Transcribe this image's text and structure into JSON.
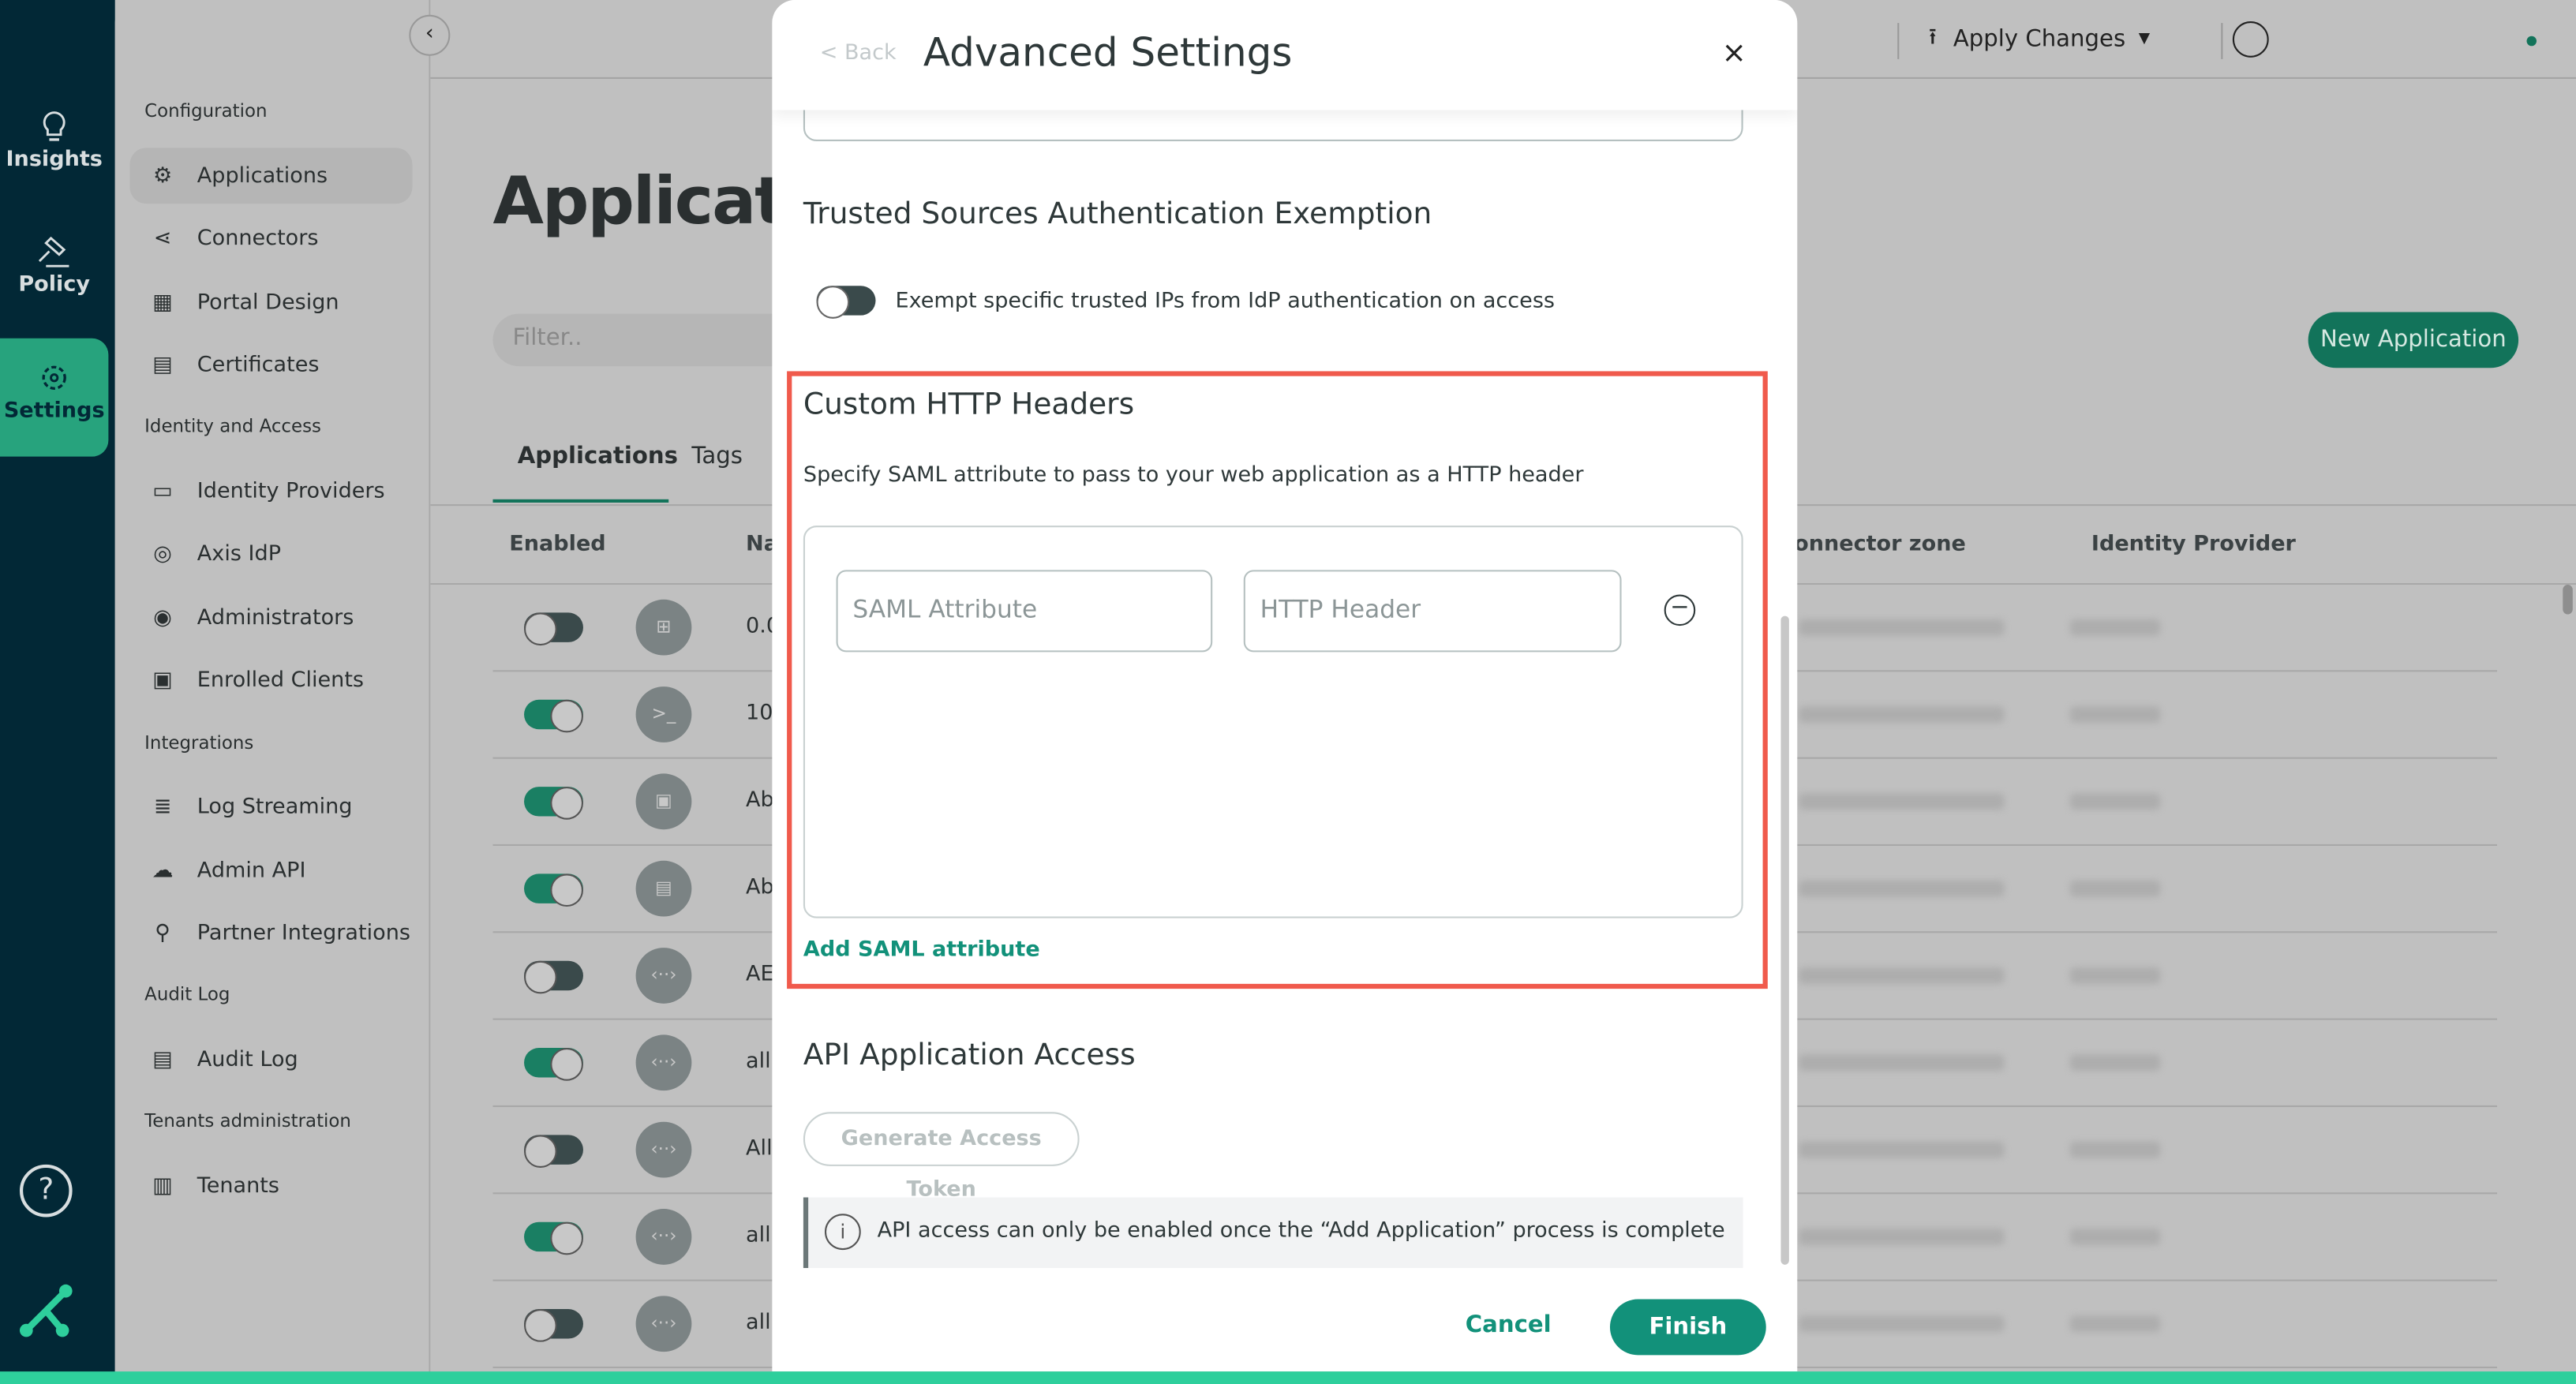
{
  "rail": {
    "items": [
      {
        "label": "Insights",
        "icon": "lightbulb-icon"
      },
      {
        "label": "Policy",
        "icon": "gavel-icon"
      },
      {
        "label": "Settings",
        "icon": "gear-icon",
        "active": true
      }
    ],
    "help_icon": "question-icon",
    "logo_icon": "axis-logo-icon"
  },
  "subnav": {
    "sections": [
      {
        "title": "Configuration",
        "items": [
          "Applications",
          "Connectors",
          "Portal Design",
          "Certificates"
        ]
      },
      {
        "title": "Identity and Access",
        "items": [
          "Identity Providers",
          "Axis IdP",
          "Administrators",
          "Enrolled Clients"
        ]
      },
      {
        "title": "Integrations",
        "items": [
          "Log Streaming",
          "Admin API",
          "Partner Integrations"
        ]
      },
      {
        "title": "Audit Log",
        "items": [
          "Audit Log"
        ]
      },
      {
        "title": "Tenants administration",
        "items": [
          "Tenants"
        ]
      }
    ],
    "active": "Applications"
  },
  "topbar": {
    "apply_changes": "Apply Changes"
  },
  "page": {
    "title": "Applications",
    "filter_placeholder": "Filter..",
    "new_application": "New Application",
    "tabs": [
      "Applications",
      "Tags"
    ],
    "columns": {
      "enabled": "Enabled",
      "name": "Na",
      "connector_zone": "onnector zone",
      "identity_provider": "Identity Provider"
    },
    "rows": [
      {
        "enabled": false,
        "name": "0.0"
      },
      {
        "enabled": true,
        "name": "10"
      },
      {
        "enabled": true,
        "name": "Ab"
      },
      {
        "enabled": true,
        "name": "Ab"
      },
      {
        "enabled": false,
        "name": "AE"
      },
      {
        "enabled": true,
        "name": "all"
      },
      {
        "enabled": false,
        "name": "All"
      },
      {
        "enabled": true,
        "name": "all"
      },
      {
        "enabled": false,
        "name": "all"
      }
    ]
  },
  "modal": {
    "back": "< Back",
    "title": "Advanced Settings",
    "close": "×",
    "trusted": {
      "title": "Trusted Sources Authentication Exemption",
      "toggle_label": "Exempt specific trusted IPs from IdP authentication on access",
      "enabled": false
    },
    "headers": {
      "title": "Custom HTTP Headers",
      "description": "Specify SAML attribute to pass to your web application as a HTTP header",
      "saml_placeholder": "SAML Attribute",
      "http_placeholder": "HTTP Header",
      "add_label": "Add SAML attribute"
    },
    "api": {
      "title": "API Application Access",
      "generate": "Generate Access Token",
      "info": "API access can only be enabled once the “Add Application” process is complete"
    },
    "cancel": "Cancel",
    "finish": "Finish"
  },
  "colors": {
    "accent": "#12917a",
    "rail": "#022836",
    "active_rail": "#27a37d",
    "highlight": "#f05a4c"
  }
}
